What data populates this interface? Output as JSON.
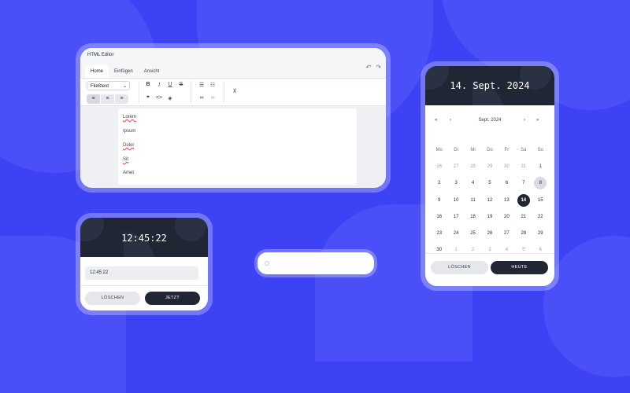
{
  "editor": {
    "title": "HTML Editor",
    "tabs": [
      "Home",
      "Einfügen",
      "Ansicht"
    ],
    "active_tab": "Home",
    "format_select": "Fließtext",
    "content_lines": [
      "Lorem",
      "Ipsum",
      "Dolor",
      "Sit",
      "Amet"
    ]
  },
  "calendar": {
    "header_date": "14. Sept. 2024",
    "month_label": "Sept. 2024",
    "nav": {
      "prev_year": "«",
      "prev_month": "‹",
      "next_month": "›",
      "next_year": "»"
    },
    "weekdays": [
      "Mo",
      "Di",
      "Mi",
      "Do",
      "Fr",
      "Sa",
      "So"
    ],
    "weeks": [
      [
        "26",
        "27",
        "28",
        "29",
        "30",
        "31",
        "1"
      ],
      [
        "2",
        "3",
        "4",
        "5",
        "6",
        "7",
        "8"
      ],
      [
        "9",
        "10",
        "11",
        "12",
        "13",
        "14",
        "15"
      ],
      [
        "16",
        "17",
        "18",
        "19",
        "20",
        "21",
        "22"
      ],
      [
        "23",
        "24",
        "25",
        "26",
        "27",
        "28",
        "29"
      ],
      [
        "30",
        "1",
        "2",
        "3",
        "4",
        "5",
        "6"
      ]
    ],
    "selected_day": "14",
    "today_day": "8",
    "clear_button": "LÖSCHEN",
    "today_button": "HEUTE"
  },
  "time": {
    "header_time": "12:45:22",
    "input_value": "12:45:22",
    "clear_button": "LÖSCHEN",
    "now_button": "JETZT"
  },
  "slider": {
    "value": 0
  },
  "colors": {
    "background": "#3d42f5",
    "dark": "#202634",
    "spellcheck": "#ef4444"
  }
}
